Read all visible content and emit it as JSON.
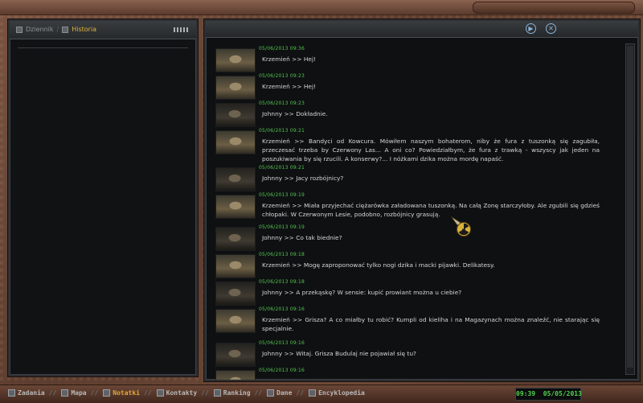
{
  "left_panel": {
    "tabs": [
      "Dziennik",
      "Historia"
    ]
  },
  "main_header": {
    "play_icon": "play-circle-icon",
    "close_icon": "close-circle-icon"
  },
  "messages": [
    {
      "time": "05/06/2013  09:36",
      "speaker": "krzemien",
      "text": "Krzemień  >>  Hej!"
    },
    {
      "time": "05/06/2013  09:23",
      "speaker": "krzemien",
      "text": "Krzemień  >>  Hej!"
    },
    {
      "time": "05/06/2013  09:23",
      "speaker": "johnny",
      "text": "Johnny  >>  Dokładnie."
    },
    {
      "time": "05/06/2013  09:21",
      "speaker": "krzemien",
      "text": "Krzemień >> Bandyci od Kowcura. Mówiłem naszym bohaterom, niby że fura z tuszonką się zagubiła, przeczesać trzeba by Czerwony Las... A oni co? Powiedziałbym, że fura z trawką - wszyscy jak jeden na poszukiwania by się rzucili. A konserwy?... I nóżkami dzika można mordę napaść."
    },
    {
      "time": "05/06/2013  09:21",
      "speaker": "johnny",
      "text": "Johnny  >>  Jacy rozbójnicy?"
    },
    {
      "time": "05/06/2013  09:19",
      "speaker": "krzemien",
      "text": "Krzemień >> Miała przyjechać ciężarówka załadowana tuszonką. Na całą Zonę starczyłoby. Ale zgubili się gdzieś chłopaki. W Czerwonym Lesie, podobno, rozbójnicy grasują."
    },
    {
      "time": "05/06/2013  09:19",
      "speaker": "johnny",
      "text": "Johnny  >>  Co tak biednie?"
    },
    {
      "time": "05/06/2013  09:18",
      "speaker": "krzemien",
      "text": "Krzemień  >>  Mogę zaproponować tylko nogi dzika i macki pijawki. Delikatesy."
    },
    {
      "time": "05/06/2013  09:18",
      "speaker": "johnny",
      "text": "Johnny  >>  A przekąskę? W sensie: kupić prowiant można u ciebie?"
    },
    {
      "time": "05/06/2013  09:16",
      "speaker": "krzemien",
      "text": "Krzemień >> Grisza? A co miałby tu robić? Kumpli od kieliha i na Magazynach można znaleźć, nie starając się specjalnie."
    },
    {
      "time": "05/06/2013  09:16",
      "speaker": "johnny",
      "text": "Johnny  >>  Witaj. Grisza Budulaj nie pojawiał się tu?"
    },
    {
      "time": "05/06/2013  09:16",
      "speaker": "krzemien",
      "text": ""
    }
  ],
  "bottom_nav": [
    {
      "label": "Zadania",
      "active": false
    },
    {
      "label": "Mapa",
      "active": false
    },
    {
      "label": "Notatki",
      "active": true
    },
    {
      "label": "Kontakty",
      "active": false
    },
    {
      "label": "Ranking",
      "active": false
    },
    {
      "label": "Dane",
      "active": false
    },
    {
      "label": "Encyklopedia",
      "active": false
    }
  ],
  "clock": {
    "time": "09:39",
    "date": "05/05/2013"
  }
}
